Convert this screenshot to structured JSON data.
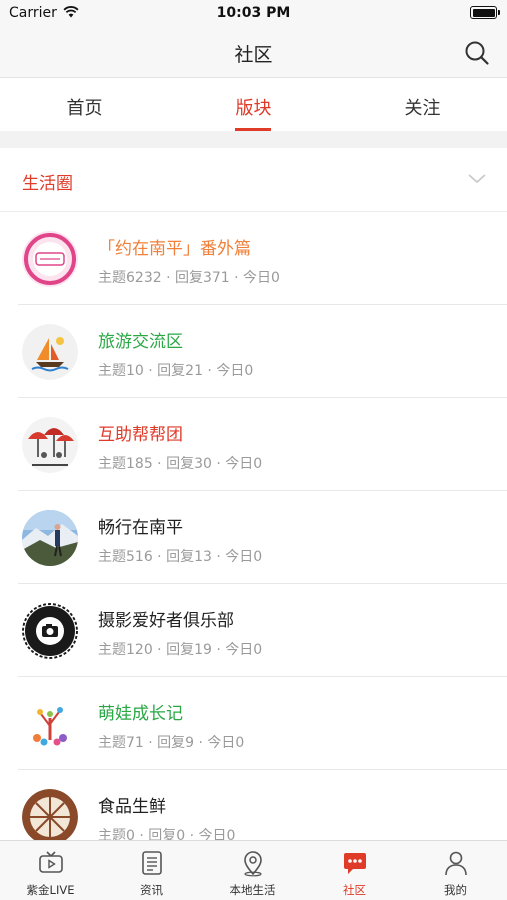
{
  "status_bar": {
    "carrier": "Carrier",
    "time": "10:03 PM"
  },
  "nav": {
    "title": "社区",
    "search_icon": "search-icon"
  },
  "tabs": [
    {
      "label": "首页",
      "active": false
    },
    {
      "label": "版块",
      "active": true
    },
    {
      "label": "关注",
      "active": false
    }
  ],
  "section": {
    "title": "生活圈",
    "collapse_icon": "chevron-down-icon"
  },
  "forums": [
    {
      "name": "「约在南平」番外篇",
      "stats": "主题6232 · 回复371 · 今日0",
      "name_color": "#f0803a",
      "avatar_icon": "yuezainanping-logo"
    },
    {
      "name": "旅游交流区",
      "stats": "主题10 · 回复21 · 今日0",
      "name_color": "#2aa845",
      "avatar_icon": "sailboat-icon"
    },
    {
      "name": "互助帮帮团",
      "stats": "主题185 · 回复30 · 今日0",
      "name_color": "#e03a28",
      "avatar_icon": "umbrella-group-icon"
    },
    {
      "name": "畅行在南平",
      "stats": "主题516 · 回复13 · 今日0",
      "name_color": "#222222",
      "avatar_icon": "hiker-photo"
    },
    {
      "name": "摄影爱好者俱乐部",
      "stats": "主题120 · 回复19 · 今日0",
      "name_color": "#222222",
      "avatar_icon": "camera-club-badge"
    },
    {
      "name": "萌娃成长记",
      "stats": "主题71 · 回复9 · 今日0",
      "name_color": "#2aa845",
      "avatar_icon": "kids-tree-icon"
    },
    {
      "name": "食品生鲜",
      "stats": "主题0 · 回复0 · 今日0",
      "name_color": "#222222",
      "avatar_icon": "orange-slice-icon"
    }
  ],
  "tab_bar": [
    {
      "label": "紫金LIVE",
      "icon": "tv-icon",
      "active": false
    },
    {
      "label": "资讯",
      "icon": "news-icon",
      "active": false
    },
    {
      "label": "本地生活",
      "icon": "location-pin-icon",
      "active": false
    },
    {
      "label": "社区",
      "icon": "chat-bubble-icon",
      "active": true
    },
    {
      "label": "我的",
      "icon": "person-icon",
      "active": false
    }
  ],
  "colors": {
    "accent": "#e03a28",
    "stats_text": "#9a9a9a"
  }
}
